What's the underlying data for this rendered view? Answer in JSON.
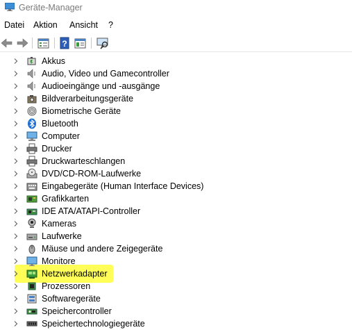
{
  "window": {
    "title": "Geräte-Manager"
  },
  "menu": [
    "Datei",
    "Aktion",
    "Ansicht",
    "?"
  ],
  "toolbar": [
    {
      "name": "back-arrow-icon"
    },
    {
      "name": "forward-arrow-icon"
    },
    {
      "name": "properties-icon"
    },
    {
      "name": "help-icon"
    },
    {
      "name": "view-icon"
    },
    {
      "name": "scan-hardware-icon"
    }
  ],
  "tree": {
    "categories": [
      {
        "label": "Akkus",
        "icon": "battery-icon"
      },
      {
        "label": "Audio, Video und Gamecontroller",
        "icon": "speaker-icon"
      },
      {
        "label": "Audioeingänge und -ausgänge",
        "icon": "speaker-icon"
      },
      {
        "label": "Bildverarbeitungsgeräte",
        "icon": "camera-icon"
      },
      {
        "label": "Biometrische Geräte",
        "icon": "fingerprint-icon"
      },
      {
        "label": "Bluetooth",
        "icon": "bluetooth-icon"
      },
      {
        "label": "Computer",
        "icon": "computer-icon"
      },
      {
        "label": "Drucker",
        "icon": "printer-icon"
      },
      {
        "label": "Druckwarteschlangen",
        "icon": "printer-icon"
      },
      {
        "label": "DVD/CD-ROM-Laufwerke",
        "icon": "disc-drive-icon"
      },
      {
        "label": "Eingabegeräte (Human Interface Devices)",
        "icon": "keyboard-icon"
      },
      {
        "label": "Grafikkarten",
        "icon": "display-adapter-icon"
      },
      {
        "label": "IDE ATA/ATAPI-Controller",
        "icon": "ide-controller-icon"
      },
      {
        "label": "Kameras",
        "icon": "webcam-icon"
      },
      {
        "label": "Laufwerke",
        "icon": "drive-icon"
      },
      {
        "label": "Mäuse und andere Zeigegeräte",
        "icon": "mouse-icon"
      },
      {
        "label": "Monitore",
        "icon": "monitor-icon"
      },
      {
        "label": "Netzwerkadapter",
        "icon": "network-adapter-icon",
        "highlighted": true
      },
      {
        "label": "Prozessoren",
        "icon": "processor-icon"
      },
      {
        "label": "Softwaregeräte",
        "icon": "software-device-icon"
      },
      {
        "label": "Speichercontroller",
        "icon": "storage-controller-icon"
      },
      {
        "label": "Speichertechnologiegeräte",
        "icon": "memory-tech-icon"
      }
    ]
  },
  "colors": {
    "highlight": "#ffff3a",
    "accent": "#1e63c6"
  }
}
